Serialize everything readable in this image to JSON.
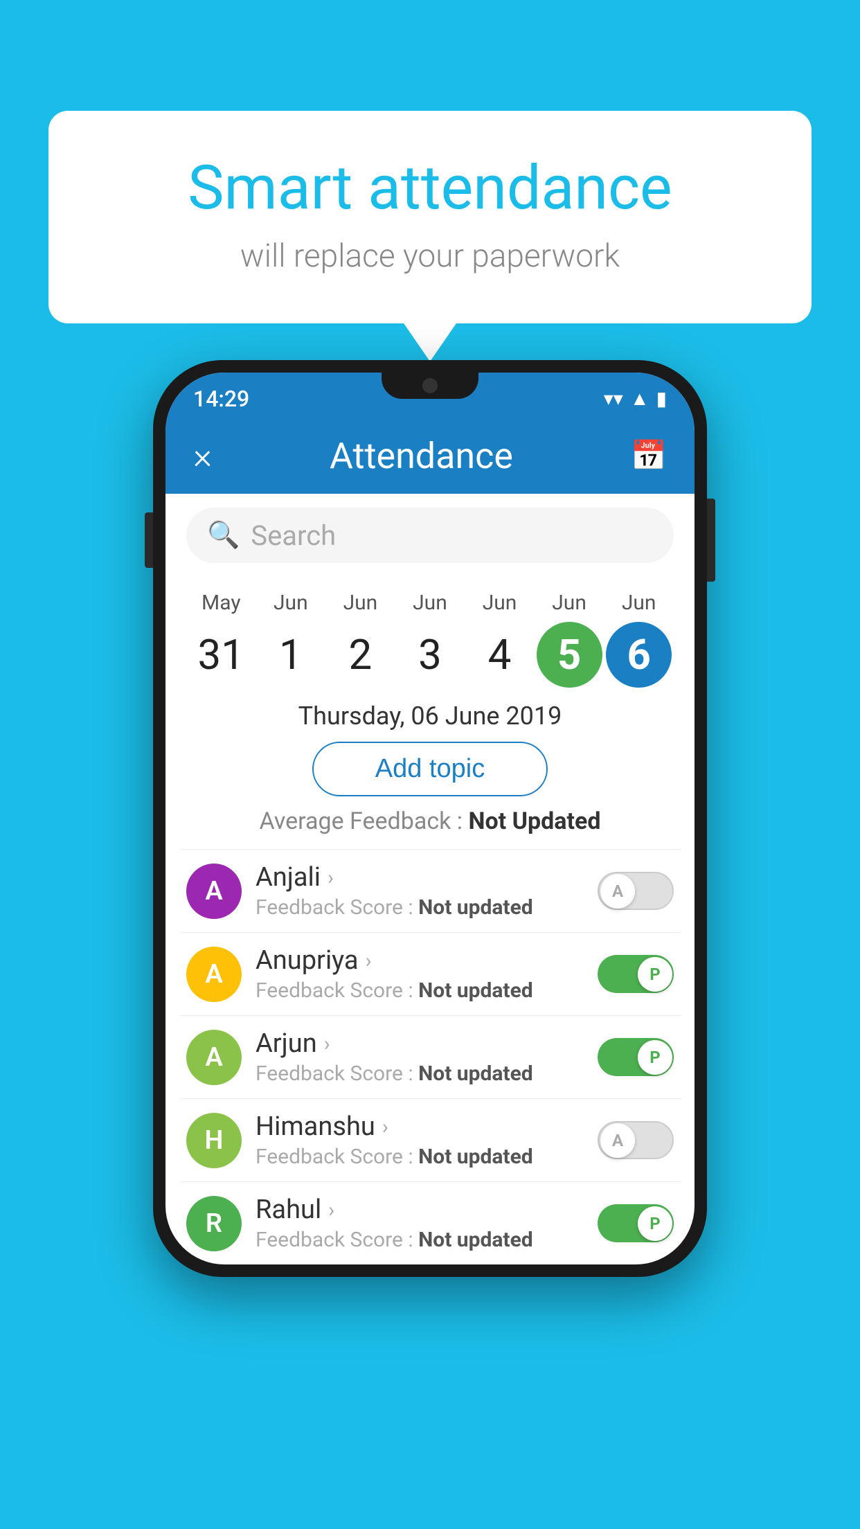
{
  "background_color": "#1BBDE8",
  "speech_bubble": {
    "title": "Smart attendance",
    "subtitle": "will replace your paperwork"
  },
  "phone": {
    "status_bar": {
      "time": "14:29",
      "wifi_icon": "▼",
      "signal_icon": "▲",
      "battery_icon": "▮"
    },
    "header": {
      "close_label": "×",
      "title": "Attendance",
      "calendar_icon": "📅"
    },
    "search": {
      "placeholder": "Search"
    },
    "dates": [
      {
        "month": "May",
        "day": "31",
        "style": "normal"
      },
      {
        "month": "Jun",
        "day": "1",
        "style": "normal"
      },
      {
        "month": "Jun",
        "day": "2",
        "style": "normal"
      },
      {
        "month": "Jun",
        "day": "3",
        "style": "normal"
      },
      {
        "month": "Jun",
        "day": "4",
        "style": "normal"
      },
      {
        "month": "Jun",
        "day": "5",
        "style": "today"
      },
      {
        "month": "Jun",
        "day": "6",
        "style": "selected"
      }
    ],
    "selected_date_label": "Thursday, 06 June 2019",
    "add_topic_label": "Add topic",
    "avg_feedback_label": "Average Feedback : ",
    "avg_feedback_value": "Not Updated",
    "students": [
      {
        "name": "Anjali",
        "avatar_letter": "A",
        "avatar_color": "#9C27B0",
        "feedback_label": "Feedback Score : ",
        "feedback_value": "Not updated",
        "toggle_state": "off",
        "toggle_letter": "A"
      },
      {
        "name": "Anupriya",
        "avatar_letter": "A",
        "avatar_color": "#FFC107",
        "feedback_label": "Feedback Score : ",
        "feedback_value": "Not updated",
        "toggle_state": "on",
        "toggle_letter": "P"
      },
      {
        "name": "Arjun",
        "avatar_letter": "A",
        "avatar_color": "#8BC34A",
        "feedback_label": "Feedback Score : ",
        "feedback_value": "Not updated",
        "toggle_state": "on",
        "toggle_letter": "P"
      },
      {
        "name": "Himanshu",
        "avatar_letter": "H",
        "avatar_color": "#8BC34A",
        "feedback_label": "Feedback Score : ",
        "feedback_value": "Not updated",
        "toggle_state": "off",
        "toggle_letter": "A"
      },
      {
        "name": "Rahul",
        "avatar_letter": "R",
        "avatar_color": "#4CAF50",
        "feedback_label": "Feedback Score : ",
        "feedback_value": "Not updated",
        "toggle_state": "on",
        "toggle_letter": "P"
      }
    ]
  }
}
